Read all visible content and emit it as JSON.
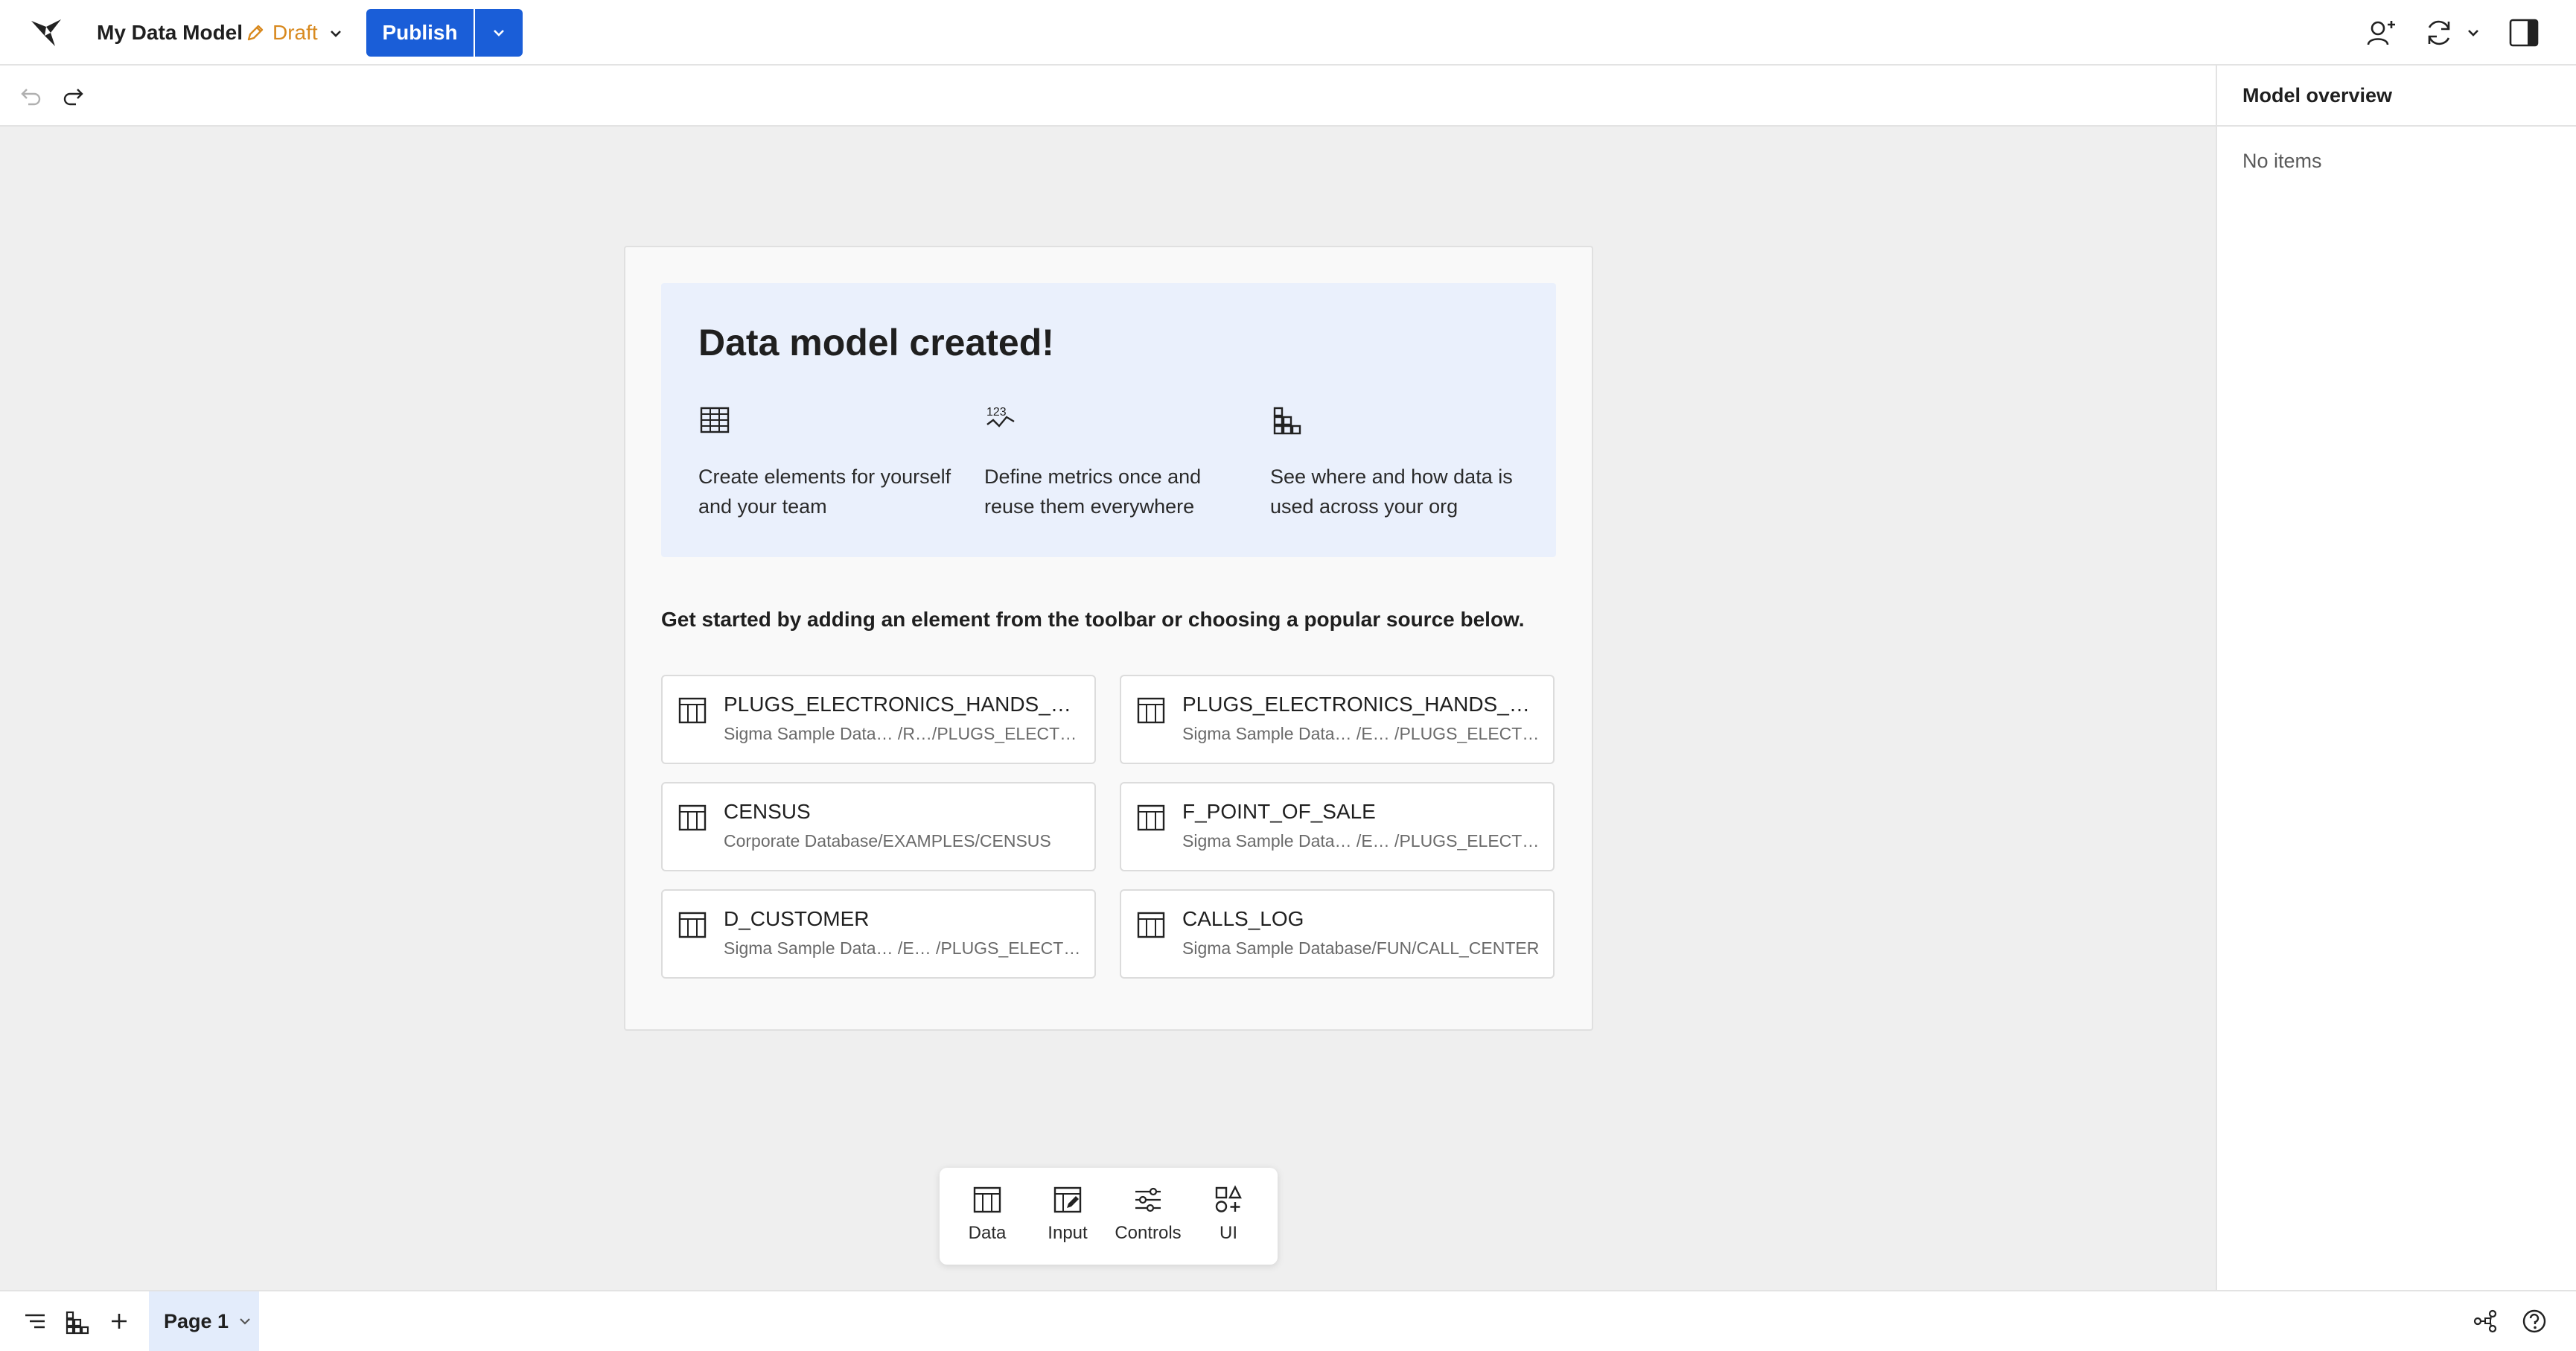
{
  "header": {
    "title": "My Data Model",
    "status": "Draft",
    "publish_label": "Publish",
    "icons": [
      "sigma-logo-icon",
      "pencil-icon",
      "chevron-down-icon",
      "add-user-icon",
      "refresh-icon",
      "panel-toggle-icon"
    ]
  },
  "editbar": {
    "icons": [
      "undo-icon",
      "redo-icon"
    ]
  },
  "welcome": {
    "title": "Data model created!",
    "features": [
      {
        "icon": "table-grid-icon",
        "text": "Create elements for yourself and your team"
      },
      {
        "icon": "metrics-123-icon",
        "text": "Define metrics once and reuse them everywhere"
      },
      {
        "icon": "lineage-icon",
        "text": "See where and how data is used across your org"
      }
    ],
    "intro": "Get started by adding an element from the toolbar or choosing a popular source below.",
    "sources": [
      {
        "name": "PLUGS_ELECTRONICS_HANDS_ON_L…",
        "path": "Sigma Sample Data…  /R…/PLUGS_ELECTRO…"
      },
      {
        "name": "PLUGS_ELECTRONICS_HANDS_ON_L…",
        "path": "Sigma Sample Data…  /E…  /PLUGS_ELECTRO…"
      },
      {
        "name": "CENSUS",
        "path": "Corporate Database/EXAMPLES/CENSUS"
      },
      {
        "name": "F_POINT_OF_SALE",
        "path": "Sigma Sample Data…  /E…  /PLUGS_ELECTRO…"
      },
      {
        "name": "D_CUSTOMER",
        "path": "Sigma Sample Data…  /E…  /PLUGS_ELECTRO…"
      },
      {
        "name": "CALLS_LOG",
        "path": "Sigma Sample Database/FUN/CALL_CENTER"
      }
    ]
  },
  "toolbar": {
    "items": [
      {
        "label": "Data",
        "icon": "table-icon"
      },
      {
        "label": "Input",
        "icon": "input-table-icon"
      },
      {
        "label": "Controls",
        "icon": "sliders-icon"
      },
      {
        "label": "UI",
        "icon": "ui-shapes-icon"
      }
    ]
  },
  "overview": {
    "title": "Model overview",
    "empty": "No items"
  },
  "footer": {
    "page_label": "Page 1",
    "icons": [
      "list-icon",
      "lineage-icon",
      "plus-icon",
      "chevron-down-icon",
      "share-graph-icon",
      "help-icon"
    ]
  },
  "colors": {
    "accent": "#1a5ed8",
    "draft": "#d8891e",
    "hero_bg": "#eaf0fc",
    "canvas_bg": "#efefef"
  }
}
